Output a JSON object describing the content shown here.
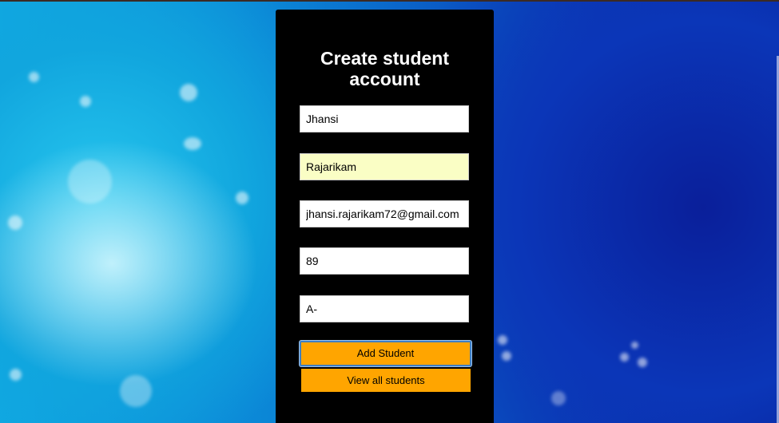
{
  "form": {
    "title": "Create student account",
    "fields": [
      {
        "name": "first-name-input",
        "value": "Jhansi",
        "autofill": false
      },
      {
        "name": "last-name-input",
        "value": "Rajarikam",
        "autofill": true
      },
      {
        "name": "email-input",
        "value": "jhansi.rajarikam72@gmail.com",
        "autofill": false
      },
      {
        "name": "marks-input",
        "value": "89",
        "autofill": false
      },
      {
        "name": "grade-input",
        "value": "A-",
        "autofill": false
      }
    ],
    "add_button_label": "Add Student",
    "view_button_label": "View all students"
  },
  "colors": {
    "panel": "#000000",
    "button": "#ffa500",
    "autofill_field": "#fafec5",
    "focus_ring": "#3f7fc3"
  }
}
